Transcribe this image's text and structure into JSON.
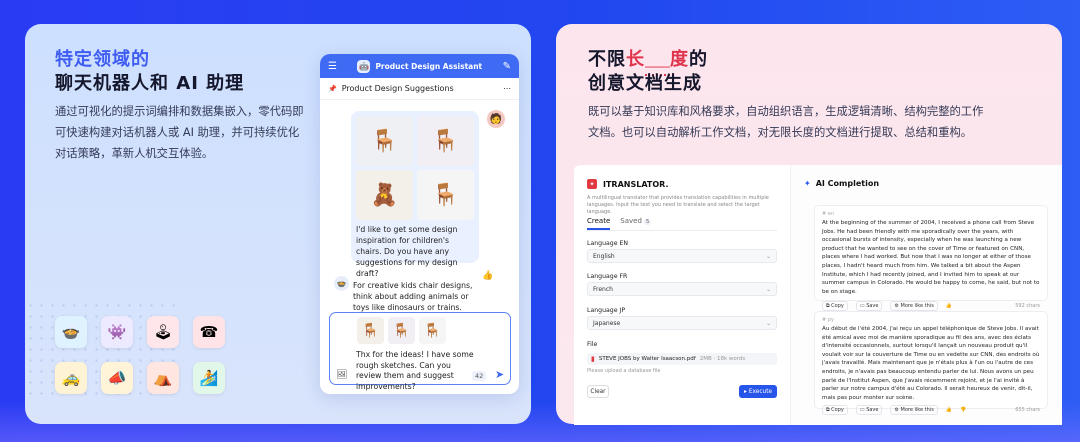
{
  "left": {
    "heading_line1": "特定领域的",
    "heading_line2": "聊天机器人和 AI 助理",
    "description": "通过可视化的提示词编排和数据集嵌入，零代码即可快速构建对话机器人或 AI 助理，并可持续优化对话策略，革新人机交互体验。"
  },
  "chat_app": {
    "title": "Product Design Assistant",
    "conversation_title": "Product Design Suggestions",
    "user_message": "I'd like to get some design inspiration for children's chairs. Do you have any suggestions for my design draft?",
    "bot_message": "For creative kids chair designs, think about adding animals or toys like dinosaurs or trains.",
    "composer_text": "Thx for the ideas! I have some rough sketches. Can you review them and suggest improvements?",
    "composer_count": "42"
  },
  "right": {
    "heading_prefix": "不限",
    "heading_mid": "长",
    "heading_blank": "_____",
    "heading_suffix": "度的",
    "heading_line2": "创意文档生成",
    "description": "既可以基于知识库和风格要求，自动组织语言，生成逻辑清晰、结构完整的工作文档。也可以自动解析工作文档，对无限长度的文档进行提取、总结和重构。"
  },
  "translator": {
    "title": "ITRANSLATOR.",
    "subtitle": "A multilingual translator that provides translation capabilities in multiple languages. Input the text you need to translate and select the target language.",
    "tab_create": "Create",
    "tab_saved": "Saved",
    "saved_count": "5",
    "lang1_label": "Language EN",
    "lang1_value": "English",
    "lang2_label": "Language FR",
    "lang2_value": "French",
    "lang3_label": "Language JP",
    "lang3_value": "Japanese",
    "file_label": "File",
    "file_name": "STEVE JOBS by Walter Isaacson.pdf",
    "file_meta": "2MB · 18k words",
    "hint": "Please upload a database file",
    "clear": "Clear",
    "execute": "Execute"
  },
  "ai": {
    "title": "AI Completion",
    "card1_lang": "# en",
    "card1_text": "At the beginning of the summer of 2004, I received a phone call from Steve Jobs. He had been friendly with me sporadically over the years, with occasional bursts of intensity, especially when he was launching a new product that he wanted to see on the cover of Time or featured on CNN, places where I had worked. But now that I was no longer at either of those places, I hadn't heard much from him. We talked a bit about the Aspen Institute, which I had recently joined, and I invited him to speak at our summer campus in Colorado. He would be happy to come, he said, but not to be on stage.",
    "card1_chars": "592 chars",
    "card2_lang": "# py",
    "card2_text": "Au début de l'été 2004, j'ai reçu un appel téléphonique de Steve Jobs. Il avait été amical avec moi de manière sporadique au fil des ans, avec des éclats d'intensité occasionnels, surtout lorsqu'il lançait un nouveau produit qu'il voulait voir sur la couverture de Time ou en vedette sur CNN, des endroits où j'avais travaillé. Mais maintenant que je n'étais plus à l'un ou l'autre de ces endroits, je n'avais pas beaucoup entendu parler de lui. Nous avons un peu parlé de l'Institut Aspen, que j'avais récemment rejoint, et je l'ai invité à parler sur notre campus d'été au Colorado. Il serait heureux de venir, dit-il, mais pas pour monter sur scène.",
    "card2_chars": "655 chars",
    "copy": "Copy",
    "save": "Save",
    "more": "More like this"
  },
  "colors": {
    "brand_blue": "#3f6bf4",
    "accent_red": "#e0344d",
    "bg_blue": "#2147f0"
  }
}
